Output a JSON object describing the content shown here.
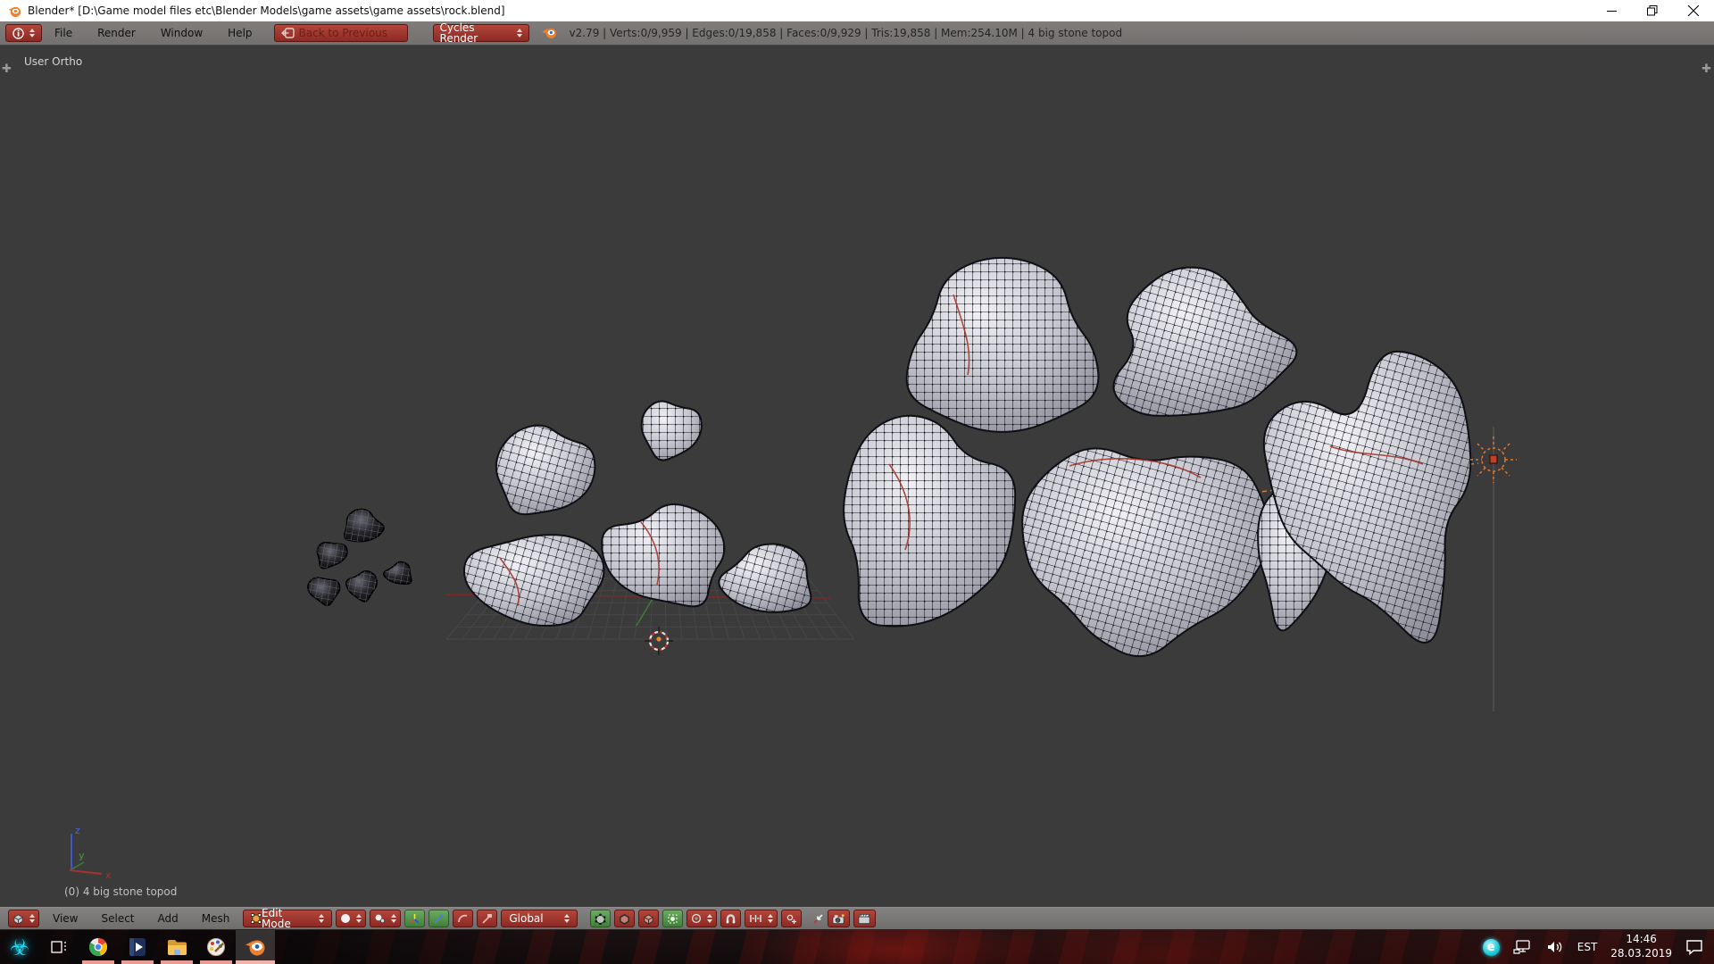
{
  "window": {
    "app_icon": "blender-logo",
    "title": "Blender* [D:\\Game model files etc\\Blender Models\\game assets\\game assets\\rock.blend]",
    "controls": {
      "minimize": "minimize",
      "restore": "restore-down",
      "close": "close"
    }
  },
  "menubar": {
    "editor_selector_icon": "info-editor-icon",
    "menus": [
      "File",
      "Render",
      "Window",
      "Help"
    ],
    "back_button": "Back to Previous",
    "engine_select": "Cycles Render",
    "stats": "v2.79 | Verts:0/9,959 | Edges:0/19,858 | Faces:0/9,929 | Tris:19,858 | Mem:254.10M | 4 big stone topod"
  },
  "viewport": {
    "view_label": "User Ortho",
    "status_label": "(0) 4 big stone topod",
    "axis_labels": {
      "x": "x",
      "y": "y",
      "z": "z"
    }
  },
  "header3d": {
    "editor_selector_icon": "viewport-editor-icon",
    "menus": [
      "View",
      "Select",
      "Add",
      "Mesh"
    ],
    "mode_select": "Edit Mode",
    "orientation_select": "Global"
  },
  "taskbar": {
    "apps": [
      "start-biohazard",
      "task-view",
      "chrome",
      "media-player",
      "file-explorer",
      "paint",
      "blender"
    ],
    "active_app": "blender",
    "tray": {
      "antivirus_icon": "eset",
      "network_icon": "network",
      "volume_icon": "volume",
      "language": "EST",
      "time": "14:46",
      "date": "28.03.2019",
      "action_center_icon": "action-center"
    }
  },
  "colors": {
    "button_red": "#a23229",
    "header_grey": "#7b7875",
    "viewport_bg": "#3b3b3b",
    "selection_green": "#56a156",
    "empty_orange": "#e07830"
  }
}
